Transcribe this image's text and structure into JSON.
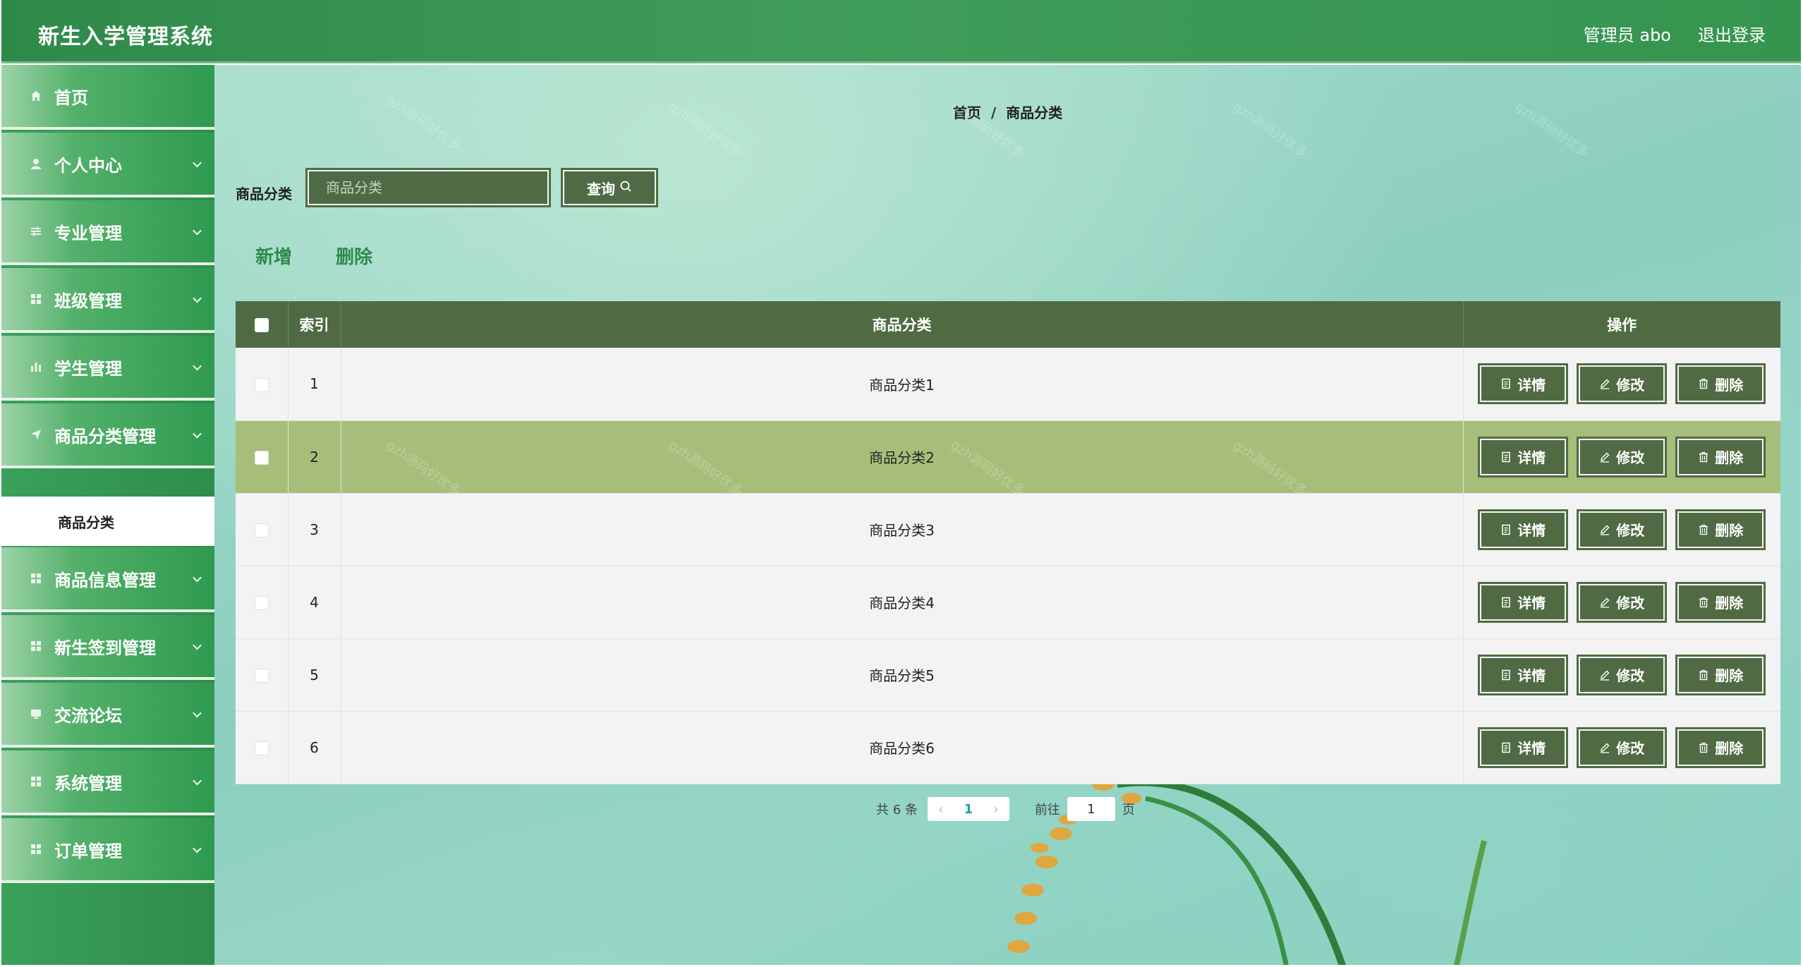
{
  "header": {
    "title": "新生入学管理系统",
    "user_label": "管理员 abo",
    "logout_label": "退出登录"
  },
  "sidebar": {
    "items": [
      {
        "label": "首页",
        "icon": "home-icon"
      },
      {
        "label": "个人中心",
        "icon": "user-icon"
      },
      {
        "label": "专业管理",
        "icon": "sliders-icon"
      },
      {
        "label": "班级管理",
        "icon": "grid-icon"
      },
      {
        "label": "学生管理",
        "icon": "bar-chart-icon"
      },
      {
        "label": "商品分类管理",
        "icon": "send-icon"
      },
      {
        "label": "商品信息管理",
        "icon": "grid-icon"
      },
      {
        "label": "新生签到管理",
        "icon": "grid-icon"
      },
      {
        "label": "交流论坛",
        "icon": "monitor-icon"
      },
      {
        "label": "系统管理",
        "icon": "grid-icon"
      },
      {
        "label": "订单管理",
        "icon": "grid-icon"
      }
    ],
    "sub_item": "商品分类"
  },
  "breadcrumb": {
    "home": "首页",
    "sep": "/",
    "current": "商品分类"
  },
  "search": {
    "label": "商品分类",
    "placeholder": "商品分类",
    "value": "",
    "button_label": "查询"
  },
  "actions": {
    "add_label": "新增",
    "delete_label": "删除"
  },
  "table": {
    "headers": {
      "index": "索引",
      "category": "商品分类",
      "ops": "操作"
    },
    "rows": [
      {
        "index": "1",
        "category": "商品分类1"
      },
      {
        "index": "2",
        "category": "商品分类2"
      },
      {
        "index": "3",
        "category": "商品分类3"
      },
      {
        "index": "4",
        "category": "商品分类4"
      },
      {
        "index": "5",
        "category": "商品分类5"
      },
      {
        "index": "6",
        "category": "商品分类6"
      }
    ],
    "op_labels": {
      "detail": "详情",
      "edit": "修改",
      "delete": "删除"
    },
    "highlight_row": 2
  },
  "pagination": {
    "total_text": "共 6 条",
    "current_page": "1",
    "goto_label": "前往",
    "goto_value": "1",
    "page_suffix": "页"
  },
  "watermark_text": "gzh源码好优多"
}
